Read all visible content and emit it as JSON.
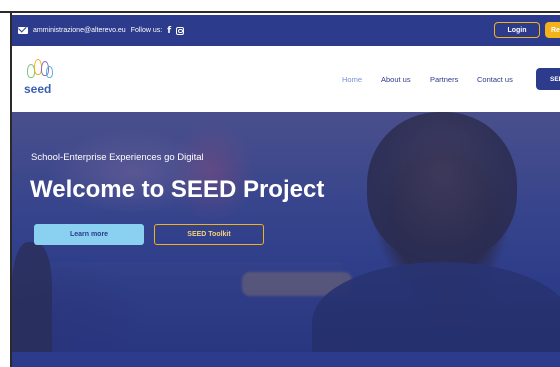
{
  "topbar": {
    "email": "amministrazione@alterevo.eu",
    "follow_label": "Follow us:",
    "facebook_icon": "f",
    "login_label": "Login",
    "register_label": "Reg"
  },
  "navbar": {
    "logo_text": "seed",
    "items": [
      {
        "label": "Home"
      },
      {
        "label": "About us"
      },
      {
        "label": "Partners"
      },
      {
        "label": "Contact us"
      }
    ],
    "cta_label": "SEE"
  },
  "hero": {
    "subtitle": "School-Enterprise Experiences go Digital",
    "title": "Welcome to SEED Project",
    "learn_more_label": "Learn more",
    "toolkit_label": "SEED Toolkit"
  },
  "colors": {
    "primary": "#2c3b8c",
    "accent": "#f2b21c",
    "light_blue": "#8ad0f0",
    "active_nav": "#7a8fd8"
  },
  "icons": [
    "mail-icon",
    "facebook-icon",
    "instagram-icon",
    "seed-logo"
  ]
}
